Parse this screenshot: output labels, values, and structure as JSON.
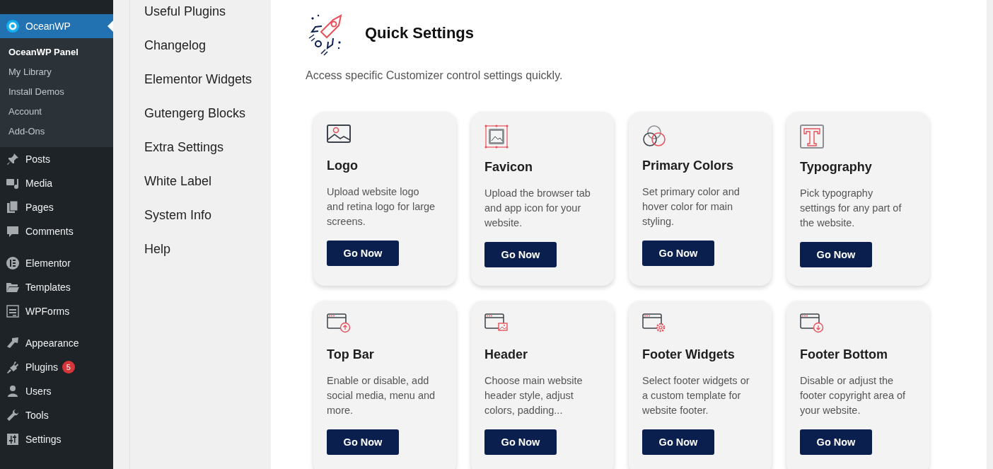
{
  "admin_menu": {
    "groups": [
      [
        {
          "label": "OceanWP",
          "kind": "oceanwp",
          "selected": true,
          "submenu": [
            {
              "label": "OceanWP Panel",
              "selected": true
            },
            {
              "label": "My Library",
              "selected": false
            },
            {
              "label": "Install Demos",
              "selected": false
            },
            {
              "label": "Account",
              "selected": false
            },
            {
              "label": "Add-Ons",
              "selected": false
            }
          ]
        },
        {
          "label": "Posts",
          "kind": "pin",
          "selected": false
        },
        {
          "label": "Media",
          "kind": "media",
          "selected": false
        },
        {
          "label": "Pages",
          "kind": "pages",
          "selected": false
        },
        {
          "label": "Comments",
          "kind": "comments",
          "selected": false
        }
      ],
      [
        {
          "label": "Elementor",
          "kind": "elementor",
          "selected": false
        },
        {
          "label": "Templates",
          "kind": "folder",
          "selected": false
        },
        {
          "label": "WPForms",
          "kind": "forms",
          "selected": false
        }
      ],
      [
        {
          "label": "Appearance",
          "kind": "brush",
          "selected": false
        },
        {
          "label": "Plugins",
          "kind": "plug",
          "selected": false,
          "badge": "5"
        },
        {
          "label": "Users",
          "kind": "user",
          "selected": false
        },
        {
          "label": "Tools",
          "kind": "wrench",
          "selected": false
        },
        {
          "label": "Settings",
          "kind": "sliders",
          "selected": false
        }
      ]
    ]
  },
  "panel_nav": {
    "items": [
      "Useful Plugins",
      "Changelog",
      "Elementor Widgets",
      "Gutengerg Blocks",
      "Extra Settings",
      "White Label",
      "System Info",
      "Help"
    ]
  },
  "quick_settings": {
    "title": "Quick Settings",
    "description": "Access specific Customizer control settings quickly.",
    "cards": [
      {
        "kind": "logo",
        "title": "Logo",
        "text": "Upload website logo and retina logo for large screens.",
        "button": "Go Now"
      },
      {
        "kind": "favicon",
        "title": "Favicon",
        "text": "Upload the browser tab and app icon for your website.",
        "button": "Go Now"
      },
      {
        "kind": "colors",
        "title": "Primary Colors",
        "text": "Set primary color and hover color for main styling.",
        "button": "Go Now"
      },
      {
        "kind": "typography",
        "title": "Typography",
        "text": "Pick typography settings for any part of the website.",
        "button": "Go Now"
      },
      {
        "kind": "topbar",
        "title": "Top Bar",
        "text": "Enable or disable, add social media, menu and more.",
        "button": "Go Now"
      },
      {
        "kind": "header",
        "title": "Header",
        "text": "Choose main website header style, adjust colors, padding...",
        "button": "Go Now"
      },
      {
        "kind": "footer_widgets",
        "title": "Footer Widgets",
        "text": "Select footer widgets or a custom template for website footer.",
        "button": "Go Now"
      },
      {
        "kind": "footer_bottom",
        "title": "Footer Bottom",
        "text": "Disable or adjust the footer copyright area of your website.",
        "button": "Go Now"
      }
    ]
  }
}
